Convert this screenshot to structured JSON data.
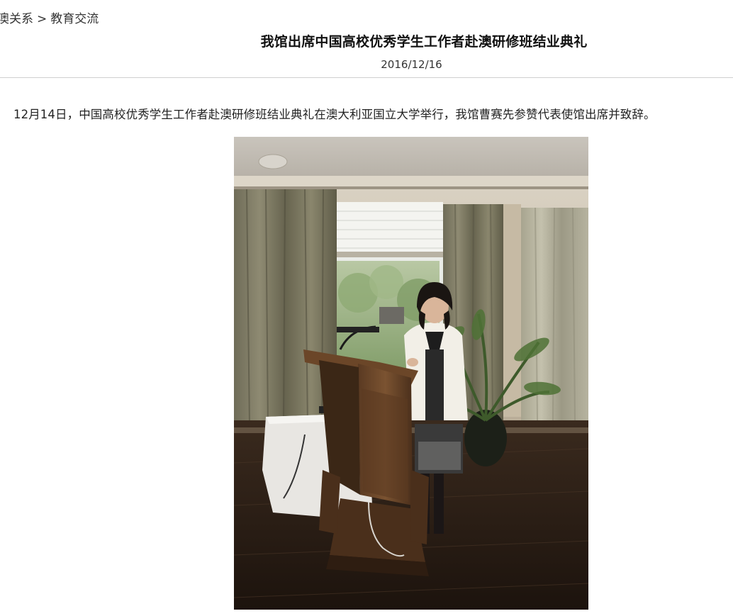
{
  "breadcrumb": {
    "items": [
      "澳关系",
      "教育交流"
    ],
    "separator": ">"
  },
  "article": {
    "title": "我馆出席中国高校优秀学生工作者赴澳研修班结业典礼",
    "date": "2016/12/16",
    "paragraph": "12月14日，中国高校优秀学生工作者赴澳研修班结业典礼在澳大利亚国立大学举行，我馆曹赛先参赞代表使馆出席并致辞。"
  },
  "photo": {
    "subject": "speaker at wooden podium in a room with curtains and a window"
  }
}
